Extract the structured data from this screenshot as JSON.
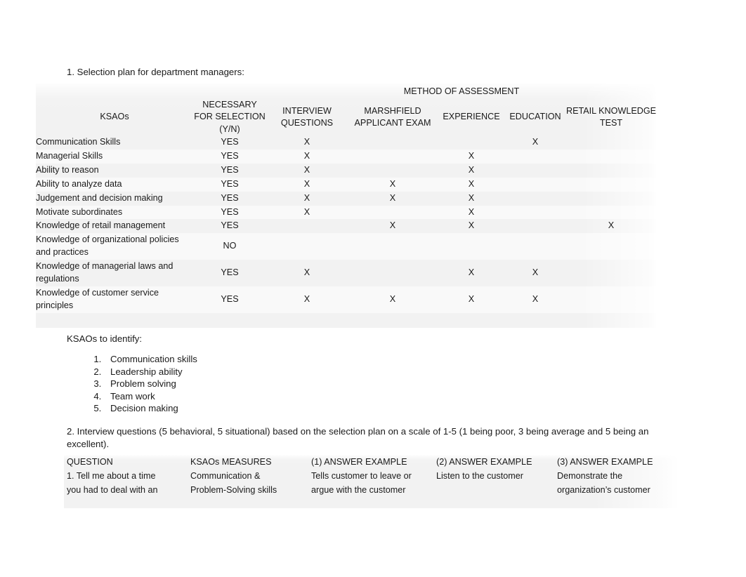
{
  "document": {
    "heading_1": "1. Selection plan for department managers:",
    "ksaos_identify_label": "KSAOs to identify:",
    "interview_paragraph": "2. Interview questions (5 behavioral, 5 situational) based on the selection plan on a scale of 1-5 (1 being poor, 3 being average and 5 being an excellent)."
  },
  "selection_plan_table": {
    "group_header": "METHOD OF ASSESSMENT",
    "headers": {
      "ksaos": "KSAOs",
      "necessary": "NECESSARY FOR SELECTION (Y/N)",
      "interview": "INTERVIEW QUESTIONS",
      "marshfield": "MARSHFIELD APPLICANT EXAM",
      "experience": "EXPERIENCE",
      "education": "EDUCATION",
      "retail": "RETAIL KNOWLEDGE TEST"
    },
    "rows": [
      {
        "ksao": "Communication Skills",
        "necessary": "YES",
        "interview": "X",
        "marshfield": "",
        "experience": "",
        "education": "X",
        "retail": ""
      },
      {
        "ksao": "Managerial Skills",
        "necessary": "YES",
        "interview": "X",
        "marshfield": "",
        "experience": "X",
        "education": "",
        "retail": ""
      },
      {
        "ksao": "Ability to reason",
        "necessary": "YES",
        "interview": "X",
        "marshfield": "",
        "experience": "X",
        "education": "",
        "retail": ""
      },
      {
        "ksao": "Ability to analyze data",
        "necessary": "YES",
        "interview": "X",
        "marshfield": "X",
        "experience": "X",
        "education": "",
        "retail": ""
      },
      {
        "ksao": "Judgement and decision making",
        "necessary": "YES",
        "interview": "X",
        "marshfield": "X",
        "experience": "X",
        "education": "",
        "retail": ""
      },
      {
        "ksao": "Motivate subordinates",
        "necessary": "YES",
        "interview": "X",
        "marshfield": "",
        "experience": "X",
        "education": "",
        "retail": ""
      },
      {
        "ksao": "Knowledge of retail management",
        "necessary": "YES",
        "interview": "",
        "marshfield": "X",
        "experience": "X",
        "education": "",
        "retail": "X"
      },
      {
        "ksao": "Knowledge of organizational policies and practices",
        "necessary": "NO",
        "interview": "",
        "marshfield": "",
        "experience": "",
        "education": "",
        "retail": ""
      },
      {
        "ksao": "Knowledge of managerial laws and regulations",
        "necessary": "YES",
        "interview": "X",
        "marshfield": "",
        "experience": "X",
        "education": "X",
        "retail": ""
      },
      {
        "ksao": "Knowledge of customer service principles",
        "necessary": "YES",
        "interview": "X",
        "marshfield": "X",
        "experience": "X",
        "education": "X",
        "retail": ""
      }
    ]
  },
  "ksaos_to_identify": [
    "Communication skills",
    "Leadership ability",
    "Problem solving",
    "Team work",
    "Decision making"
  ],
  "interview_questions_table": {
    "headers": [
      "QUESTION",
      "KSAOs MEASURES",
      "(1) ANSWER EXAMPLE",
      "(2) ANSWER EXAMPLE",
      "(3) ANSWER EXAMPLE"
    ],
    "rows": [
      {
        "question_line1": "1. Tell me about a time",
        "question_line2": "you had to deal with an",
        "measures_line1": "Communication &",
        "measures_line2": "Problem-Solving skills",
        "answer1_line1": "Tells customer to leave or",
        "answer1_line2": "argue with the customer",
        "answer2_line1": "Listen to the customer",
        "answer2_line2": "",
        "answer3_line1": "Demonstrate the",
        "answer3_line2": "organization’s customer"
      }
    ]
  },
  "colors": {
    "page_background": "#ffffff",
    "table_background": "#f2f2f2",
    "text": "#1a1a1a"
  }
}
